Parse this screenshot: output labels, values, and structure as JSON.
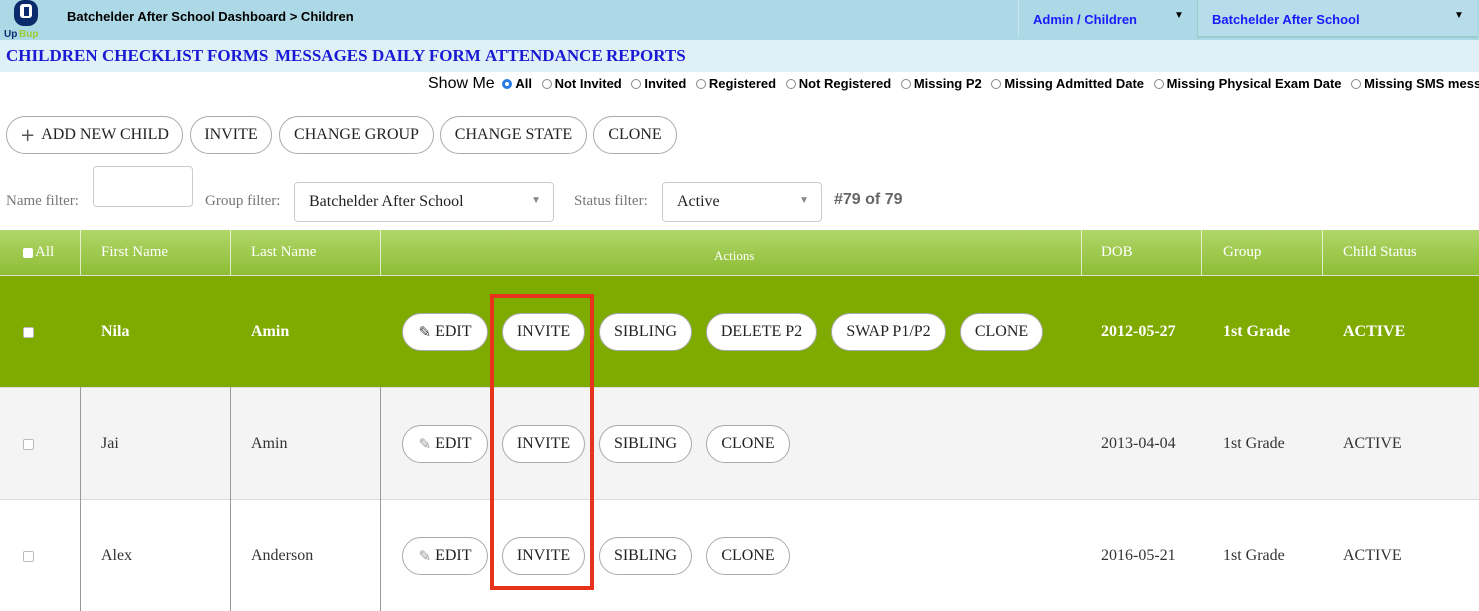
{
  "header": {
    "breadcrumb": "Batchelder After School Dashboard > Children",
    "logo_text": "UpBup",
    "admin_select": "Admin / Children",
    "school_select": "Batchelder After School"
  },
  "nav": [
    "CHILDREN",
    "CHECKLIST",
    "FORMS",
    "MESSAGES",
    "DAILY FORM",
    "ATTENDANCE",
    "REPORTS"
  ],
  "show_me": {
    "label": "Show Me",
    "options": [
      "All",
      "Not Invited",
      "Invited",
      "Registered",
      "Not Registered",
      "Missing P2",
      "Missing Admitted Date",
      "Missing Physical Exam Date",
      "Missing SMS messag"
    ],
    "selected": "All"
  },
  "toolbar": {
    "add_new_child": "ADD NEW CHILD",
    "invite": "INVITE",
    "change_group": "CHANGE GROUP",
    "change_state": "CHANGE STATE",
    "clone": "CLONE"
  },
  "filters": {
    "name_label": "Name filter:",
    "name_value": "",
    "group_label": "Group filter:",
    "group_value": "Batchelder After School",
    "status_label": "Status filter:",
    "status_value": "Active",
    "count": "#79 of 79"
  },
  "table": {
    "headers": {
      "all": "All",
      "first_name": "First Name",
      "last_name": "Last Name",
      "actions": "Actions",
      "dob": "DOB",
      "group": "Group",
      "status": "Child Status"
    },
    "rows": [
      {
        "first": "Nila",
        "last": "Amin",
        "dob": "2012-05-27",
        "group": "1st Grade",
        "status": "ACTIVE",
        "actions": [
          "EDIT",
          "INVITE",
          "SIBLING",
          "DELETE P2",
          "SWAP P1/P2",
          "CLONE"
        ]
      },
      {
        "first": "Jai",
        "last": "Amin",
        "dob": "2013-04-04",
        "group": "1st Grade",
        "status": "ACTIVE",
        "actions": [
          "EDIT",
          "INVITE",
          "SIBLING",
          "CLONE"
        ]
      },
      {
        "first": "Alex",
        "last": "Anderson",
        "dob": "2016-05-21",
        "group": "1st Grade",
        "status": "ACTIVE",
        "actions": [
          "EDIT",
          "INVITE",
          "SIBLING",
          "CLONE"
        ]
      }
    ]
  },
  "colors": {
    "top_bar": "#add8e6",
    "nav_link": "#1a1ad4",
    "header_green": "#8dbd34",
    "selected_row": "#7faa00",
    "highlight": "#e8331c"
  }
}
